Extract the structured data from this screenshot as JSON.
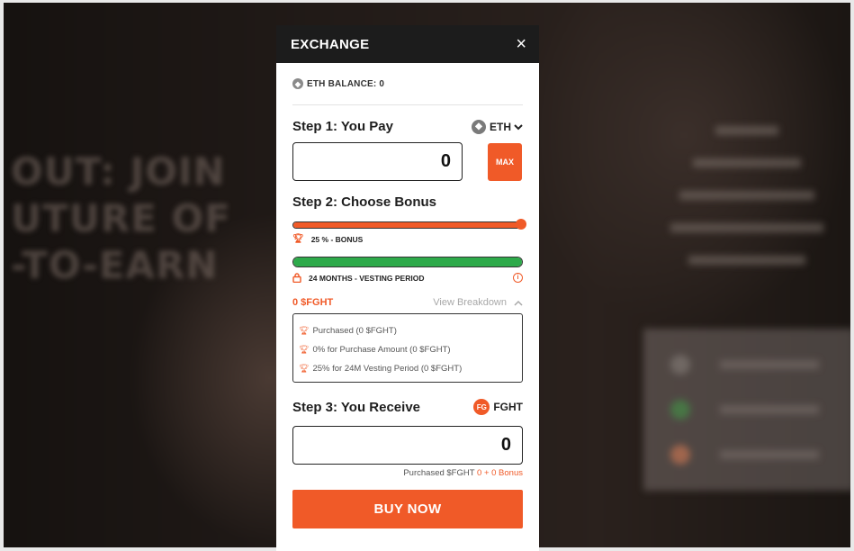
{
  "modal": {
    "title": "EXCHANGE",
    "close_symbol": "×"
  },
  "balance": {
    "label": "ETH BALANCE: 0"
  },
  "step1": {
    "title": "Step 1: You Pay",
    "token": "ETH",
    "amount": "0",
    "max_label": "MAX"
  },
  "step2": {
    "title": "Step 2: Choose Bonus",
    "bonus_label": "25 % - BONUS",
    "bonus_level": 1.0,
    "vesting_label": "24 MONTHS - VESTING PERIOD",
    "vesting_level": 1.0
  },
  "breakdown": {
    "total": "0 $FGHT",
    "toggle_label": "View Breakdown",
    "items": [
      "Purchased (0 $FGHT)",
      "0% for Purchase Amount (0 $FGHT)",
      "25% for 24M Vesting Period (0 $FGHT)"
    ]
  },
  "step3": {
    "title": "Step 3: You Receive",
    "token": "FGHT",
    "amount": "0",
    "note_prefix": "Purchased $FGHT",
    "note_accent": "0 + 0 Bonus"
  },
  "buy_button": "BUY NOW",
  "colors": {
    "accent": "#f05a28",
    "vesting_green": "#2daa4a",
    "header_dark": "#1c1c1c"
  },
  "icons": {
    "eth": "ethereum-icon",
    "fght": "fght-token-icon",
    "trophy": "trophy-icon",
    "lock": "lock-icon",
    "info": "info-icon"
  }
}
